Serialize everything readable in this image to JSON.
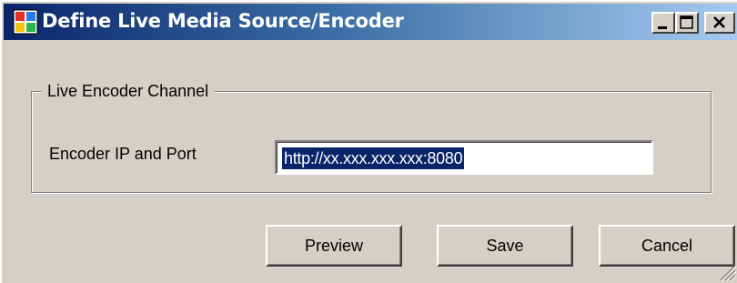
{
  "window": {
    "title": "Define Live Media Source/Encoder",
    "icon": "app-window-icon",
    "controls": [
      "minimize-icon",
      "maximize-icon",
      "close-icon"
    ]
  },
  "group": {
    "legend": "Live Encoder Channel",
    "field_label": "Encoder IP and Port",
    "field_value": "http://xx.xxx.xxx.xxx:8080"
  },
  "buttons": {
    "preview": "Preview",
    "save": "Save",
    "cancel": "Cancel"
  },
  "colors": {
    "titlebar_start": "#0a246a",
    "titlebar_end": "#a6caf0",
    "dialog_face": "#d4d0c8",
    "selection": "#0a246a"
  }
}
